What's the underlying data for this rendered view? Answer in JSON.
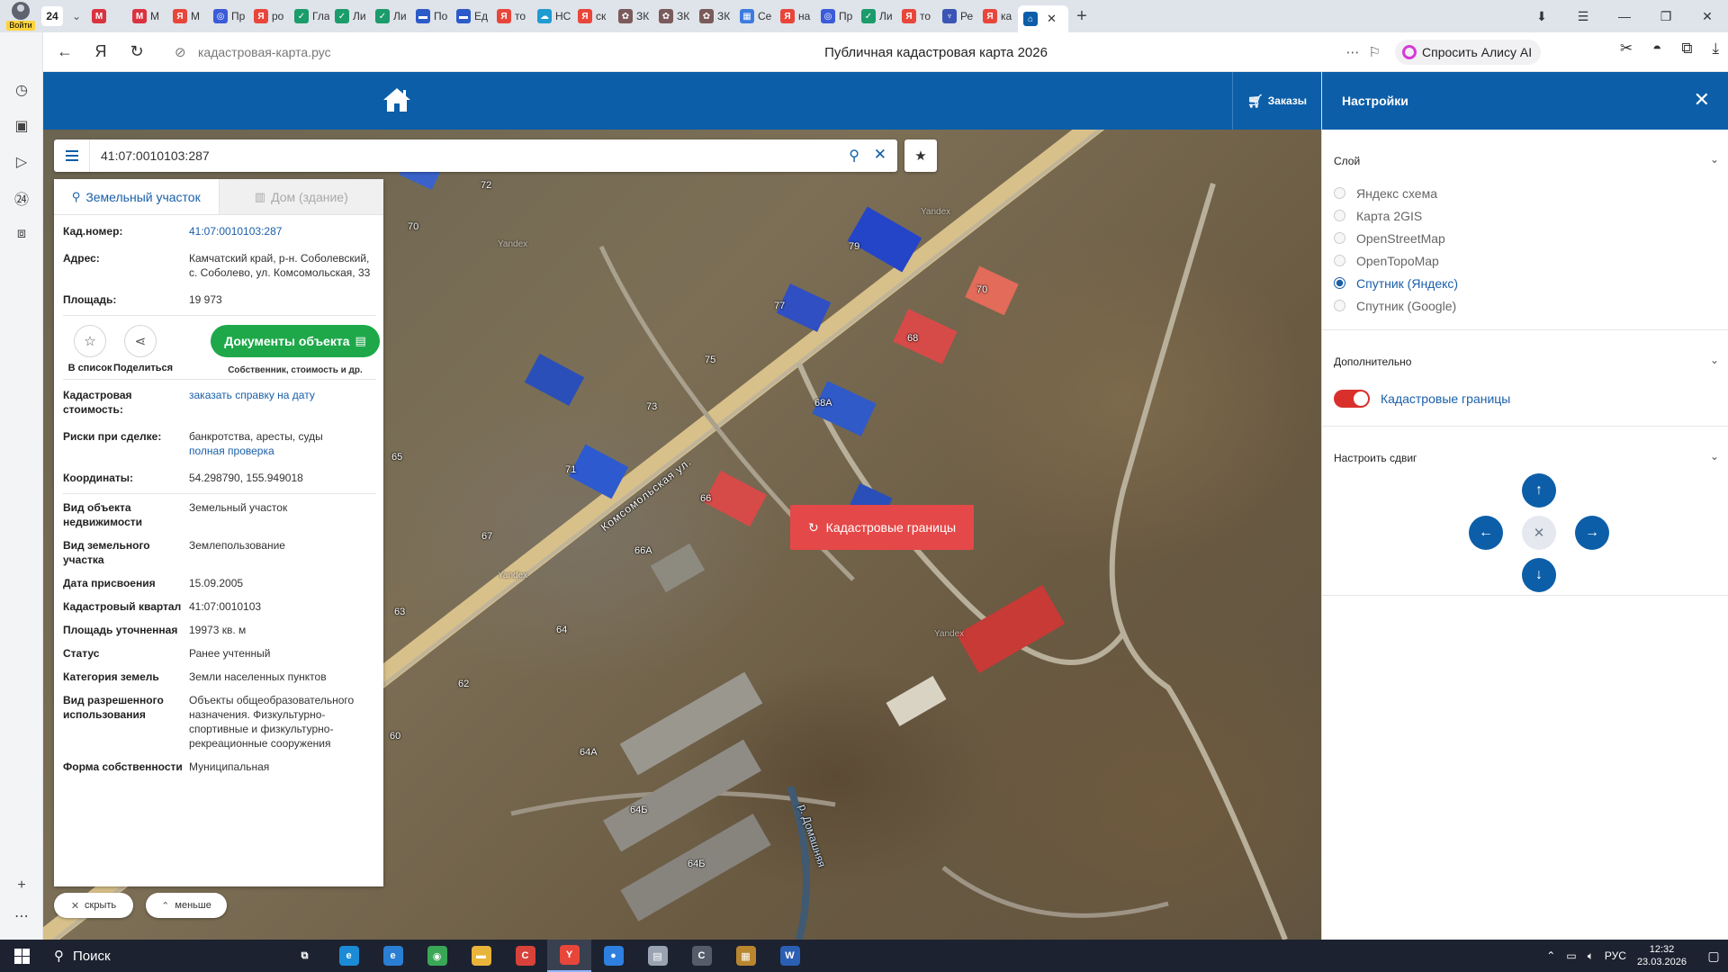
{
  "browser": {
    "login_label": "Войти",
    "tab_count": "24",
    "tabs": [
      {
        "icon": "mail-icon",
        "color": "#d9333f",
        "glyph": "M",
        "label": ""
      },
      {
        "icon": "mail-icon",
        "color": "#d9333f",
        "glyph": "M",
        "label": "М"
      },
      {
        "icon": "yandex-icon",
        "color": "#e8463a",
        "glyph": "Я",
        "label": "М"
      },
      {
        "icon": "shield-icon",
        "color": "#3b5bd9",
        "glyph": "◎",
        "label": "Пр"
      },
      {
        "icon": "yandex-icon",
        "color": "#e8463a",
        "glyph": "Я",
        "label": "ро"
      },
      {
        "icon": "gov-icon",
        "color": "#1b9c6b",
        "glyph": "✓",
        "label": "Гла"
      },
      {
        "icon": "gov-icon",
        "color": "#1b9c6b",
        "glyph": "✓",
        "label": "Ли"
      },
      {
        "icon": "gov-icon",
        "color": "#1b9c6b",
        "glyph": "✓",
        "label": "Ли"
      },
      {
        "icon": "flag-icon",
        "color": "#2c5bc9",
        "glyph": "▬",
        "label": "По"
      },
      {
        "icon": "flag-icon",
        "color": "#2c5bc9",
        "glyph": "▬",
        "label": "Ед"
      },
      {
        "icon": "yandex-icon",
        "color": "#e8463a",
        "glyph": "Я",
        "label": "то"
      },
      {
        "icon": "cloud-icon",
        "color": "#1f9bd1",
        "glyph": "☁",
        "label": "НС"
      },
      {
        "icon": "yandex-icon",
        "color": "#e8463a",
        "glyph": "Я",
        "label": "ск"
      },
      {
        "icon": "gear-icon",
        "color": "#7a5a5a",
        "glyph": "✿",
        "label": "ЗК"
      },
      {
        "icon": "gear-icon",
        "color": "#7a5a5a",
        "glyph": "✿",
        "label": "ЗК"
      },
      {
        "icon": "gear-icon",
        "color": "#7a5a5a",
        "glyph": "✿",
        "label": "ЗК"
      },
      {
        "icon": "grid-icon",
        "color": "#3d7be0",
        "glyph": "▦",
        "label": "Се"
      },
      {
        "icon": "yandex-icon",
        "color": "#e8463a",
        "glyph": "Я",
        "label": "на"
      },
      {
        "icon": "shield-icon",
        "color": "#3b5bd9",
        "glyph": "◎",
        "label": "Пр"
      },
      {
        "icon": "gov-icon",
        "color": "#1b9c6b",
        "glyph": "✓",
        "label": "Ли"
      },
      {
        "icon": "yandex-icon",
        "color": "#e8463a",
        "glyph": "Я",
        "label": "то"
      },
      {
        "icon": "eagle-icon",
        "color": "#3a55b5",
        "glyph": "♆",
        "label": "Ре"
      },
      {
        "icon": "yandex-icon",
        "color": "#e8463a",
        "glyph": "Я",
        "label": "ка"
      }
    ],
    "active_tab": {
      "icon": "home-icon",
      "color": "#0c5ea8",
      "glyph": "⌂"
    },
    "url_host": "кадастровая-карта.рус",
    "page_title": "Публичная кадастровая карта 2026",
    "alice_label": "Спросить Алису AI"
  },
  "site": {
    "orders_label": "Заказы",
    "search_value": "41:07:0010103:287"
  },
  "settings": {
    "title": "Настройки",
    "layer_title": "Слой",
    "layers": [
      {
        "label": "Яндекс схема",
        "selected": false
      },
      {
        "label": "Карта 2GIS",
        "selected": false
      },
      {
        "label": "OpenStreetMap",
        "selected": false
      },
      {
        "label": "OpenTopoMap",
        "selected": false
      },
      {
        "label": "Спутник (Яндекс)",
        "selected": true
      },
      {
        "label": "Спутник (Google)",
        "selected": false
      }
    ],
    "extra_title": "Дополнительно",
    "cadastral_toggle_label": "Кадастровые границы",
    "shift_title": "Настроить сдвиг"
  },
  "map": {
    "cadastral_button": "Кадастровые границы",
    "road_label": "Комсомольская ул.",
    "river_label": "р. Домашняя",
    "watermark": "Yandex",
    "house_numbers": [
      "72",
      "70",
      "79",
      "70",
      "77",
      "68",
      "75",
      "73",
      "68А",
      "65",
      "71",
      "66",
      "67",
      "66А",
      "63",
      "64",
      "62",
      "60",
      "64А",
      "64Б",
      "64Б"
    ]
  },
  "card": {
    "tab_land": "Земельный участок",
    "tab_house": "Дом (здание)",
    "rows_top": [
      {
        "k": "Кад.номер:",
        "v": "41:07:0010103:287",
        "link": true
      },
      {
        "k": "Адрес:",
        "v": "Камчатский край, р-н. Соболевский, с. Соболево, ул. Комсомольская, 33",
        "link": false
      },
      {
        "k": "Площадь:",
        "v": "19 973",
        "link": false
      }
    ],
    "add_to_list": "В список",
    "share": "Поделиться",
    "docs_button": "Документы объекта",
    "docs_sub": "Собственник, стоимость и др.",
    "cost_key": "Кадастровая стоимость:",
    "cost_link": "заказать справку на дату",
    "risks_key": "Риски при сделке:",
    "risks_value": "банкротства, аресты, суды",
    "risks_link": "полная проверка",
    "coords_key": "Координаты:",
    "coords_value": "54.298790, 155.949018",
    "rows_bottom": [
      {
        "k": "Вид объекта недвижимости",
        "v": "Земельный участок"
      },
      {
        "k": "Вид земельного участка",
        "v": "Землепользование"
      },
      {
        "k": "Дата присвоения",
        "v": "15.09.2005"
      },
      {
        "k": "Кадастровый квартал",
        "v": "41:07:0010103"
      },
      {
        "k": "Площадь уточненная",
        "v": "19973 кв. м"
      },
      {
        "k": "Статус",
        "v": "Ранее учтенный"
      },
      {
        "k": "Категория земель",
        "v": "Земли населенных пунктов"
      },
      {
        "k": "Вид разрешенного использования",
        "v": "Объекты общеобразовательного назначения. Физкультурно-спортивные и физкультурно-рекреационные сооружения"
      },
      {
        "k": "Форма собственности",
        "v": "Муниципальная"
      }
    ],
    "hide_label": "скрыть",
    "less_label": "меньше"
  },
  "taskbar": {
    "search_label": "Поиск",
    "apps": [
      {
        "icon": "taskview-icon",
        "color": "#1c2230",
        "glyph": "⧉",
        "active": false
      },
      {
        "icon": "edge-icon",
        "color": "#1b8bd6",
        "glyph": "e",
        "active": false
      },
      {
        "icon": "ie-icon",
        "color": "#2a7fd4",
        "glyph": "e",
        "active": false
      },
      {
        "icon": "chrome-icon",
        "color": "#3aa757",
        "glyph": "◉",
        "active": false
      },
      {
        "icon": "folder-icon",
        "color": "#e8b43a",
        "glyph": "▬",
        "active": false
      },
      {
        "icon": "app-c-icon",
        "color": "#d9423a",
        "glyph": "C",
        "active": false
      },
      {
        "icon": "yandex-browser-icon",
        "color": "#e8463a",
        "glyph": "Y",
        "active": true
      },
      {
        "icon": "app-blue-icon",
        "color": "#2d7fe0",
        "glyph": "●",
        "active": false
      },
      {
        "icon": "file-icon",
        "color": "#9aa3b2",
        "glyph": "▤",
        "active": false
      },
      {
        "icon": "app-c2-icon",
        "color": "#555c6a",
        "glyph": "C",
        "active": false
      },
      {
        "icon": "archive-icon",
        "color": "#b8862f",
        "glyph": "▦",
        "active": false
      },
      {
        "icon": "word-icon",
        "color": "#2b5fb4",
        "glyph": "W",
        "active": false
      }
    ],
    "lang": "РУС",
    "time": "12:32",
    "date": "23.03.2026"
  }
}
